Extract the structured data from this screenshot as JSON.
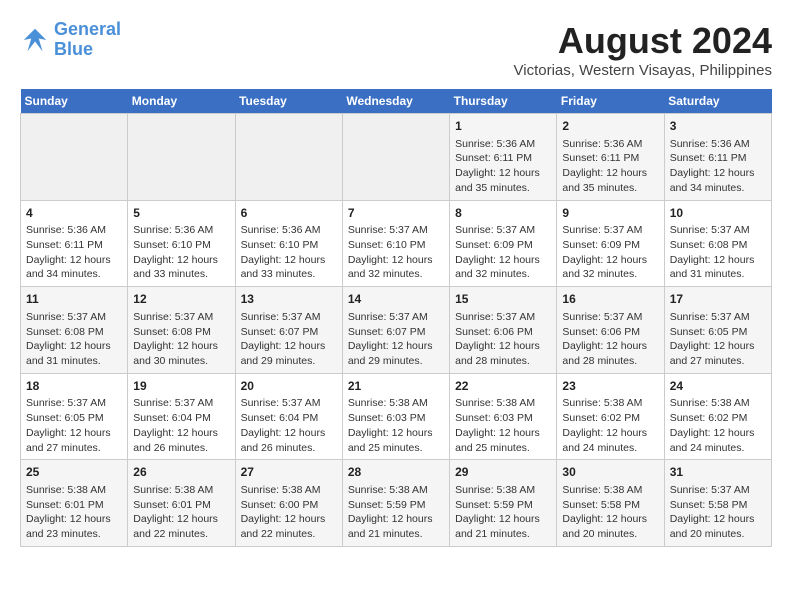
{
  "logo": {
    "line1": "General",
    "line2": "Blue"
  },
  "title": "August 2024",
  "location": "Victorias, Western Visayas, Philippines",
  "weekdays": [
    "Sunday",
    "Monday",
    "Tuesday",
    "Wednesday",
    "Thursday",
    "Friday",
    "Saturday"
  ],
  "weeks": [
    [
      {
        "day": "",
        "info": ""
      },
      {
        "day": "",
        "info": ""
      },
      {
        "day": "",
        "info": ""
      },
      {
        "day": "",
        "info": ""
      },
      {
        "day": "1",
        "info": "Sunrise: 5:36 AM\nSunset: 6:11 PM\nDaylight: 12 hours\nand 35 minutes."
      },
      {
        "day": "2",
        "info": "Sunrise: 5:36 AM\nSunset: 6:11 PM\nDaylight: 12 hours\nand 35 minutes."
      },
      {
        "day": "3",
        "info": "Sunrise: 5:36 AM\nSunset: 6:11 PM\nDaylight: 12 hours\nand 34 minutes."
      }
    ],
    [
      {
        "day": "4",
        "info": "Sunrise: 5:36 AM\nSunset: 6:11 PM\nDaylight: 12 hours\nand 34 minutes."
      },
      {
        "day": "5",
        "info": "Sunrise: 5:36 AM\nSunset: 6:10 PM\nDaylight: 12 hours\nand 33 minutes."
      },
      {
        "day": "6",
        "info": "Sunrise: 5:36 AM\nSunset: 6:10 PM\nDaylight: 12 hours\nand 33 minutes."
      },
      {
        "day": "7",
        "info": "Sunrise: 5:37 AM\nSunset: 6:10 PM\nDaylight: 12 hours\nand 32 minutes."
      },
      {
        "day": "8",
        "info": "Sunrise: 5:37 AM\nSunset: 6:09 PM\nDaylight: 12 hours\nand 32 minutes."
      },
      {
        "day": "9",
        "info": "Sunrise: 5:37 AM\nSunset: 6:09 PM\nDaylight: 12 hours\nand 32 minutes."
      },
      {
        "day": "10",
        "info": "Sunrise: 5:37 AM\nSunset: 6:08 PM\nDaylight: 12 hours\nand 31 minutes."
      }
    ],
    [
      {
        "day": "11",
        "info": "Sunrise: 5:37 AM\nSunset: 6:08 PM\nDaylight: 12 hours\nand 31 minutes."
      },
      {
        "day": "12",
        "info": "Sunrise: 5:37 AM\nSunset: 6:08 PM\nDaylight: 12 hours\nand 30 minutes."
      },
      {
        "day": "13",
        "info": "Sunrise: 5:37 AM\nSunset: 6:07 PM\nDaylight: 12 hours\nand 29 minutes."
      },
      {
        "day": "14",
        "info": "Sunrise: 5:37 AM\nSunset: 6:07 PM\nDaylight: 12 hours\nand 29 minutes."
      },
      {
        "day": "15",
        "info": "Sunrise: 5:37 AM\nSunset: 6:06 PM\nDaylight: 12 hours\nand 28 minutes."
      },
      {
        "day": "16",
        "info": "Sunrise: 5:37 AM\nSunset: 6:06 PM\nDaylight: 12 hours\nand 28 minutes."
      },
      {
        "day": "17",
        "info": "Sunrise: 5:37 AM\nSunset: 6:05 PM\nDaylight: 12 hours\nand 27 minutes."
      }
    ],
    [
      {
        "day": "18",
        "info": "Sunrise: 5:37 AM\nSunset: 6:05 PM\nDaylight: 12 hours\nand 27 minutes."
      },
      {
        "day": "19",
        "info": "Sunrise: 5:37 AM\nSunset: 6:04 PM\nDaylight: 12 hours\nand 26 minutes."
      },
      {
        "day": "20",
        "info": "Sunrise: 5:37 AM\nSunset: 6:04 PM\nDaylight: 12 hours\nand 26 minutes."
      },
      {
        "day": "21",
        "info": "Sunrise: 5:38 AM\nSunset: 6:03 PM\nDaylight: 12 hours\nand 25 minutes."
      },
      {
        "day": "22",
        "info": "Sunrise: 5:38 AM\nSunset: 6:03 PM\nDaylight: 12 hours\nand 25 minutes."
      },
      {
        "day": "23",
        "info": "Sunrise: 5:38 AM\nSunset: 6:02 PM\nDaylight: 12 hours\nand 24 minutes."
      },
      {
        "day": "24",
        "info": "Sunrise: 5:38 AM\nSunset: 6:02 PM\nDaylight: 12 hours\nand 24 minutes."
      }
    ],
    [
      {
        "day": "25",
        "info": "Sunrise: 5:38 AM\nSunset: 6:01 PM\nDaylight: 12 hours\nand 23 minutes."
      },
      {
        "day": "26",
        "info": "Sunrise: 5:38 AM\nSunset: 6:01 PM\nDaylight: 12 hours\nand 22 minutes."
      },
      {
        "day": "27",
        "info": "Sunrise: 5:38 AM\nSunset: 6:00 PM\nDaylight: 12 hours\nand 22 minutes."
      },
      {
        "day": "28",
        "info": "Sunrise: 5:38 AM\nSunset: 5:59 PM\nDaylight: 12 hours\nand 21 minutes."
      },
      {
        "day": "29",
        "info": "Sunrise: 5:38 AM\nSunset: 5:59 PM\nDaylight: 12 hours\nand 21 minutes."
      },
      {
        "day": "30",
        "info": "Sunrise: 5:38 AM\nSunset: 5:58 PM\nDaylight: 12 hours\nand 20 minutes."
      },
      {
        "day": "31",
        "info": "Sunrise: 5:37 AM\nSunset: 5:58 PM\nDaylight: 12 hours\nand 20 minutes."
      }
    ]
  ]
}
